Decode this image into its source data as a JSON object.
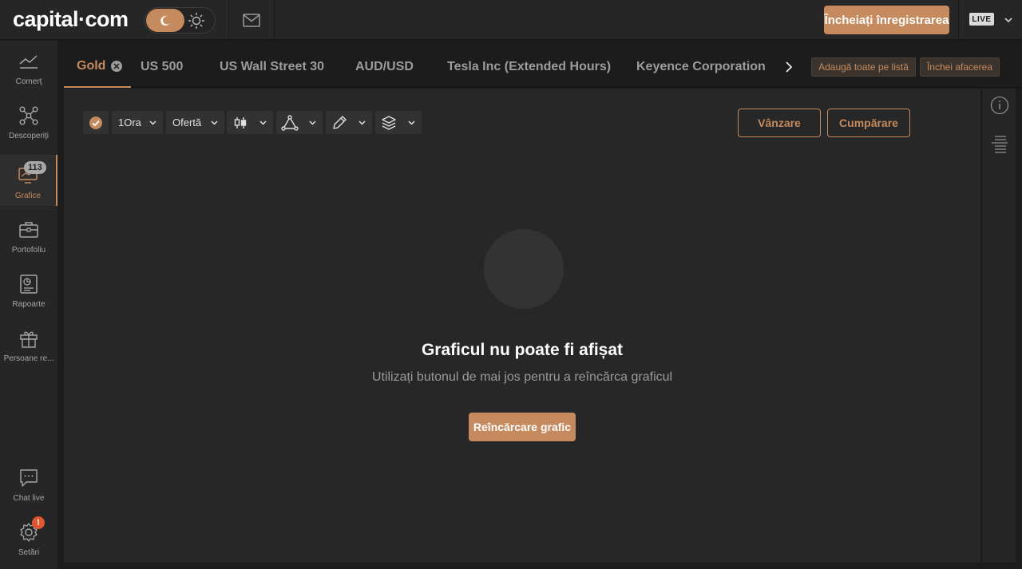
{
  "header": {
    "logo": "capital·com",
    "register_label": "Încheiați înregistrarea",
    "account_mode": "LIVE"
  },
  "sidebar": {
    "items": [
      {
        "label": "Comerț",
        "icon": "trend-line-icon"
      },
      {
        "label": "Descoperiți",
        "icon": "network-nodes-icon"
      },
      {
        "label": "Grafice",
        "icon": "monitor-chart-icon",
        "badge": "113",
        "active": true
      },
      {
        "label": "Portofoliu",
        "icon": "briefcase-icon"
      },
      {
        "label": "Rapoarte",
        "icon": "report-icon"
      },
      {
        "label": "Persoane re...",
        "icon": "gift-icon"
      }
    ],
    "bottom_items": [
      {
        "label": "Chat live",
        "icon": "chat-bubble-icon"
      },
      {
        "label": "Setări",
        "icon": "gear-icon",
        "badge": "!"
      }
    ]
  },
  "tabs": [
    {
      "label": "Gold",
      "active": true
    },
    {
      "label": "US 500"
    },
    {
      "label": "US Wall Street 30"
    },
    {
      "label": "AUD/USD"
    },
    {
      "label": "Tesla Inc (Extended Hours)"
    },
    {
      "label": "Keyence Corporation"
    }
  ],
  "tab_actions": {
    "add_all_label": "Adaugă toate pe listă",
    "close_deal_label": "Închei afacerea"
  },
  "toolbar": {
    "timeframe": "1Ora",
    "price_type": "Ofertă",
    "sell_label": "Vânzare",
    "buy_label": "Cumpărare"
  },
  "empty_state": {
    "title": "Graficul nu poate fi afișat",
    "subtitle": "Utilizați butonul de mai jos pentru a reîncărca graficul",
    "reload_label": "Reîncărcare grafic"
  },
  "colors": {
    "accent": "#c58a5e",
    "background": "#1c1c1c",
    "panel": "#272727",
    "alert": "#e0572d"
  }
}
